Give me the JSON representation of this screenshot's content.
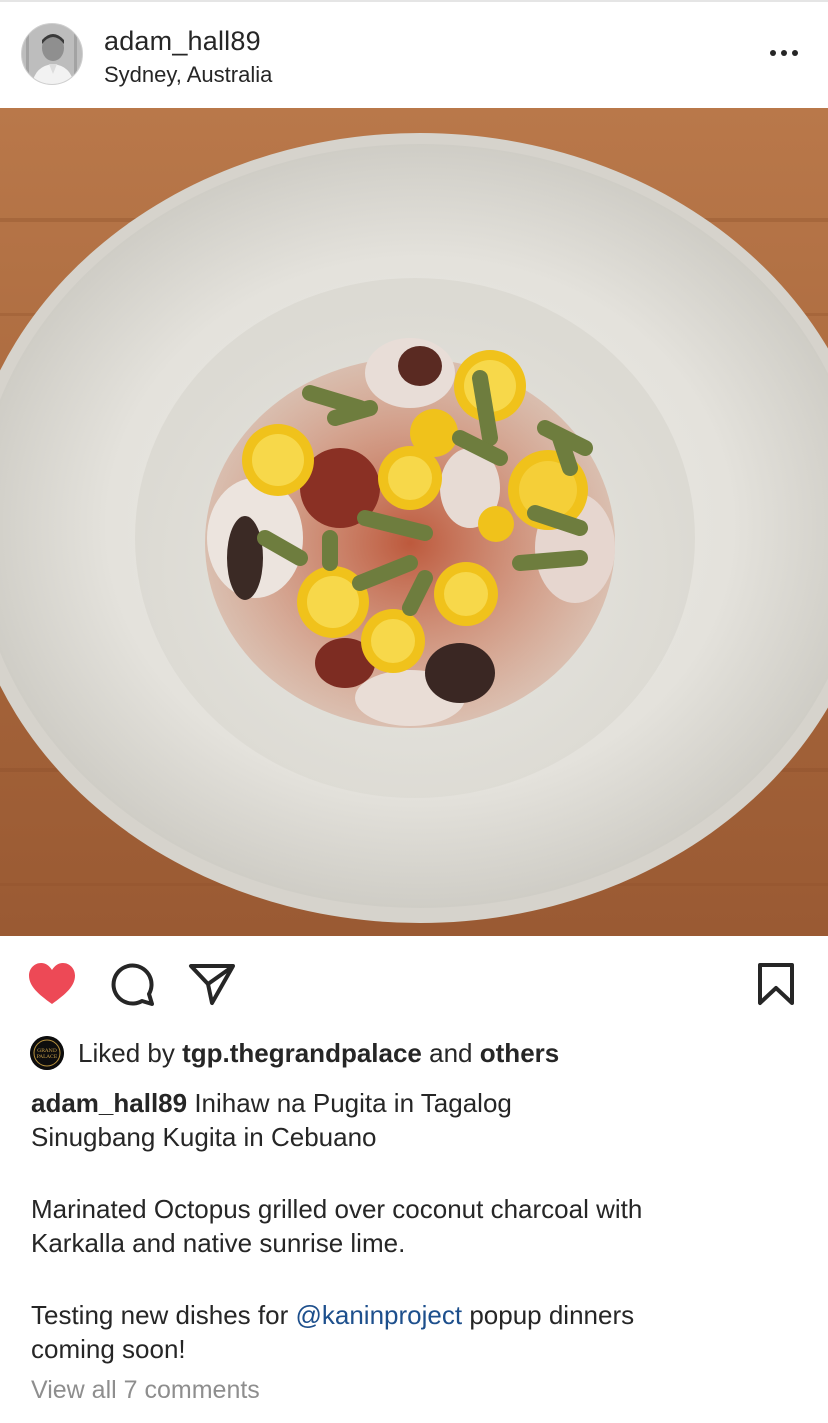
{
  "post": {
    "username": "adam_hall89",
    "location": "Sydney, Australia"
  },
  "likes": {
    "prefix": "Liked by",
    "liker": "tgp.thegrandpalace",
    "conjunction": "and",
    "others": "others",
    "liker_avatar_text": "GRAND PALACE"
  },
  "caption": {
    "username": "adam_hall89",
    "line1": "Inihaw na Pugita in Tagalog",
    "line2": "Sinugbang Kugita in Cebuano",
    "paragraph2_line1": "Marinated Octopus grilled over coconut charcoal with",
    "paragraph2_line2": "Karkalla and native sunrise lime.",
    "paragraph3_prefix": "Testing new dishes for",
    "mention": "@kaninproject",
    "paragraph3_suffix": "popup dinners",
    "paragraph3_line2": "coming soon!"
  },
  "comments": {
    "view_all_label": "View all 7 comments"
  },
  "colors": {
    "like_active": "#ed4956",
    "mention": "#1d4f8c",
    "muted_text": "#8e8e8e",
    "text": "#262626"
  },
  "icons": {
    "like": "heart-icon",
    "comment": "comment-icon",
    "share": "paper-plane-icon",
    "save": "bookmark-icon",
    "more": "more-options-icon"
  }
}
